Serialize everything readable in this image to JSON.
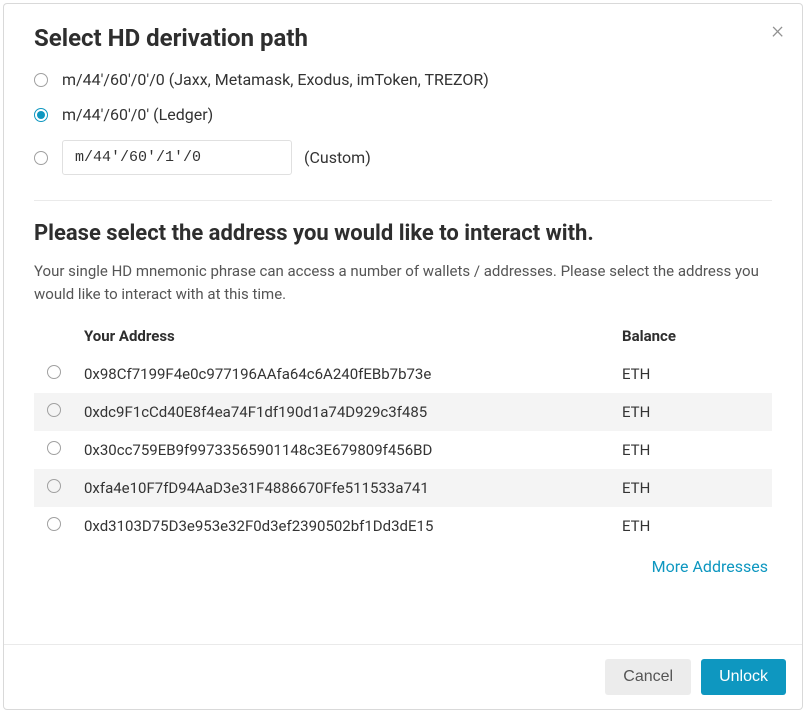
{
  "header": {
    "title": "Select HD derivation path"
  },
  "paths": {
    "option1_label": "m/44'/60'/0'/0 (Jaxx, Metamask, Exodus, imToken, TREZOR)",
    "option2_label": "m/44'/60'/0' (Ledger)",
    "custom_value": "m/44'/60'/1'/0",
    "custom_label": "(Custom)"
  },
  "address_section": {
    "title": "Please select the address you would like to interact with.",
    "helper": "Your single HD mnemonic phrase can access a number of wallets / addresses. Please select the address you would like to interact with at this time.",
    "col_address": "Your Address",
    "col_balance": "Balance",
    "rows": [
      {
        "address": "0x98Cf7199F4e0c977196AAfa64c6A240fEBb7b73e",
        "balance": "ETH"
      },
      {
        "address": "0xdc9F1cCd40E8f4ea74F1df190d1a74D929c3f485",
        "balance": "ETH"
      },
      {
        "address": "0x30cc759EB9f99733565901148c3E679809f456BD",
        "balance": "ETH"
      },
      {
        "address": "0xfa4e10F7fD94AaD3e31F4886670Ffe511533a741",
        "balance": "ETH"
      },
      {
        "address": "0xd3103D75D3e953e32F0d3ef2390502bf1Dd3dE15",
        "balance": "ETH"
      }
    ],
    "more_link": "More Addresses"
  },
  "footer": {
    "cancel": "Cancel",
    "unlock": "Unlock"
  }
}
